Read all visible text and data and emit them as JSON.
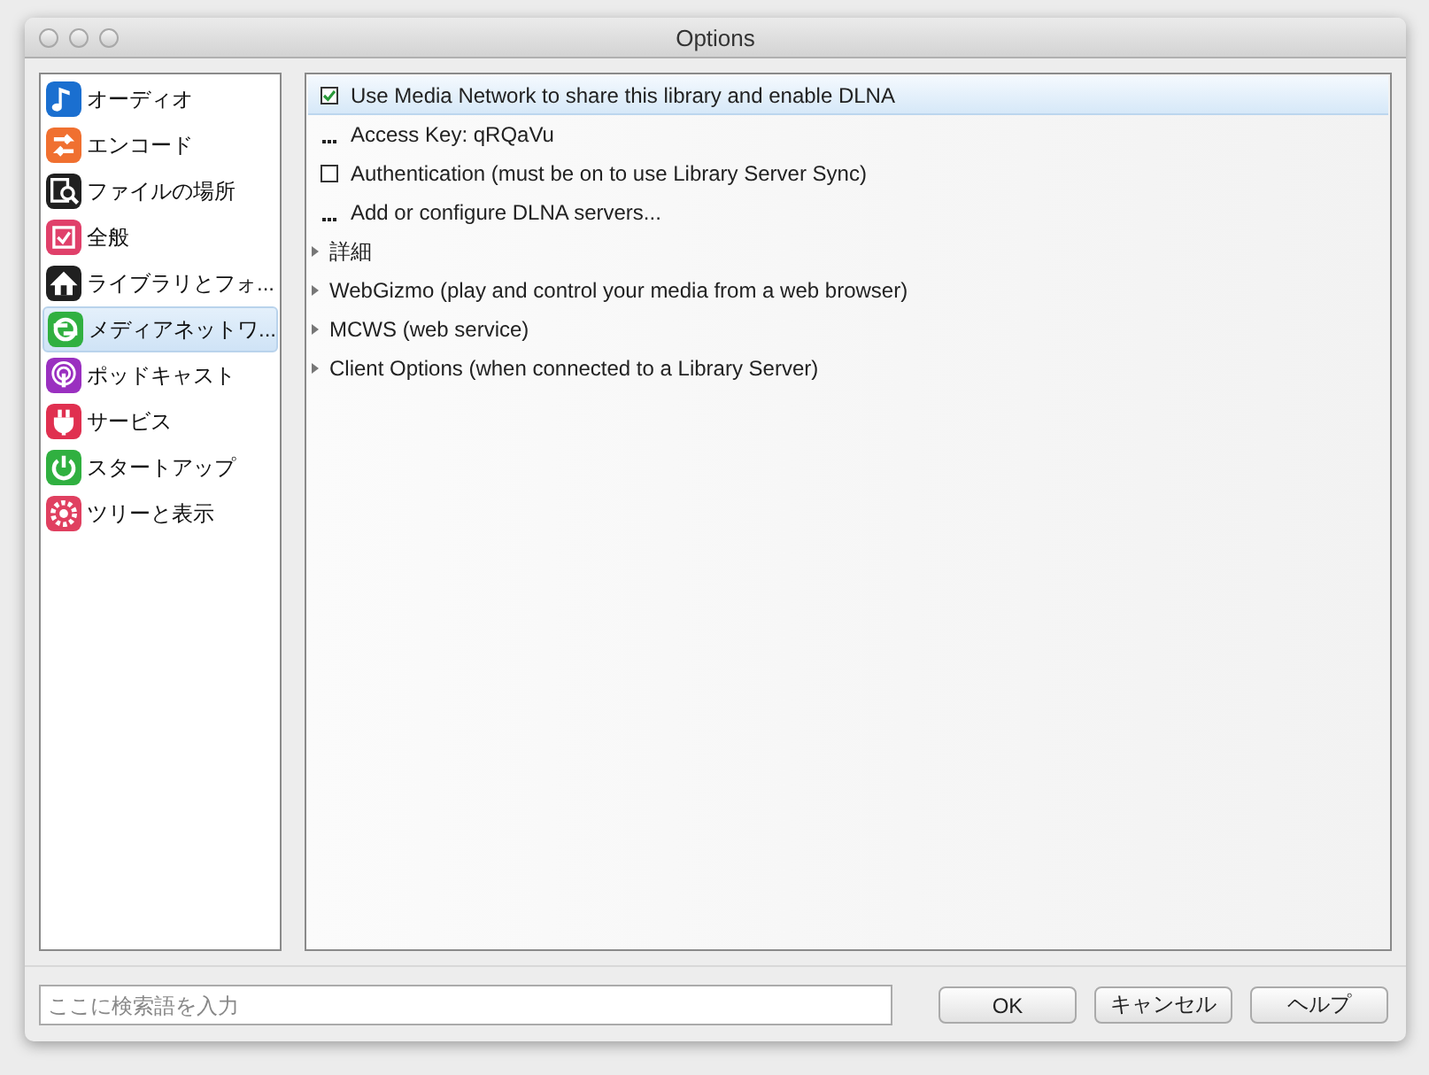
{
  "window": {
    "title": "Options"
  },
  "sidebar": {
    "items": [
      {
        "label": "オーディオ",
        "kind": "note",
        "color": "#1a6fd0",
        "selected": false
      },
      {
        "label": "エンコード",
        "kind": "arrows",
        "color": "#f07030",
        "selected": false
      },
      {
        "label": "ファイルの場所",
        "kind": "finder",
        "color": "#202020",
        "selected": false
      },
      {
        "label": "全般",
        "kind": "check",
        "color": "#e0406a",
        "selected": false
      },
      {
        "label": "ライブラリとフォ...",
        "kind": "house",
        "color": "#202020",
        "selected": false
      },
      {
        "label": "メディアネットワ...",
        "kind": "sync",
        "color": "#30b040",
        "selected": true
      },
      {
        "label": "ポッドキャスト",
        "kind": "podcast",
        "color": "#9a30c0",
        "selected": false
      },
      {
        "label": "サービス",
        "kind": "plug",
        "color": "#e03050",
        "selected": false
      },
      {
        "label": "スタートアップ",
        "kind": "power",
        "color": "#30b040",
        "selected": false
      },
      {
        "label": "ツリーと表示",
        "kind": "gear",
        "color": "#e04060",
        "selected": false
      }
    ]
  },
  "options": {
    "rows": [
      {
        "kind": "checkbox",
        "label": "Use Media Network to share this library and enable DLNA",
        "checked": true,
        "selected": true
      },
      {
        "kind": "action",
        "label": "Access Key: qRQaVu",
        "selected": false
      },
      {
        "kind": "checkbox",
        "label": "Authentication (must be on to use Library Server Sync)",
        "checked": false,
        "selected": false
      },
      {
        "kind": "action",
        "label": "Add or configure DLNA servers...",
        "selected": false
      },
      {
        "kind": "group",
        "label": "詳細",
        "expanded": false,
        "selected": false
      },
      {
        "kind": "group",
        "label": "WebGizmo (play and control your media from a web browser)",
        "expanded": false,
        "selected": false
      },
      {
        "kind": "group",
        "label": "MCWS (web service)",
        "expanded": false,
        "selected": false
      },
      {
        "kind": "group",
        "label": "Client Options (when connected to a Library Server)",
        "expanded": false,
        "selected": false
      }
    ]
  },
  "footer": {
    "search": {
      "placeholder": "ここに検索語を入力"
    },
    "buttons": [
      "OK",
      "キャンセル",
      "ヘルプ"
    ]
  }
}
